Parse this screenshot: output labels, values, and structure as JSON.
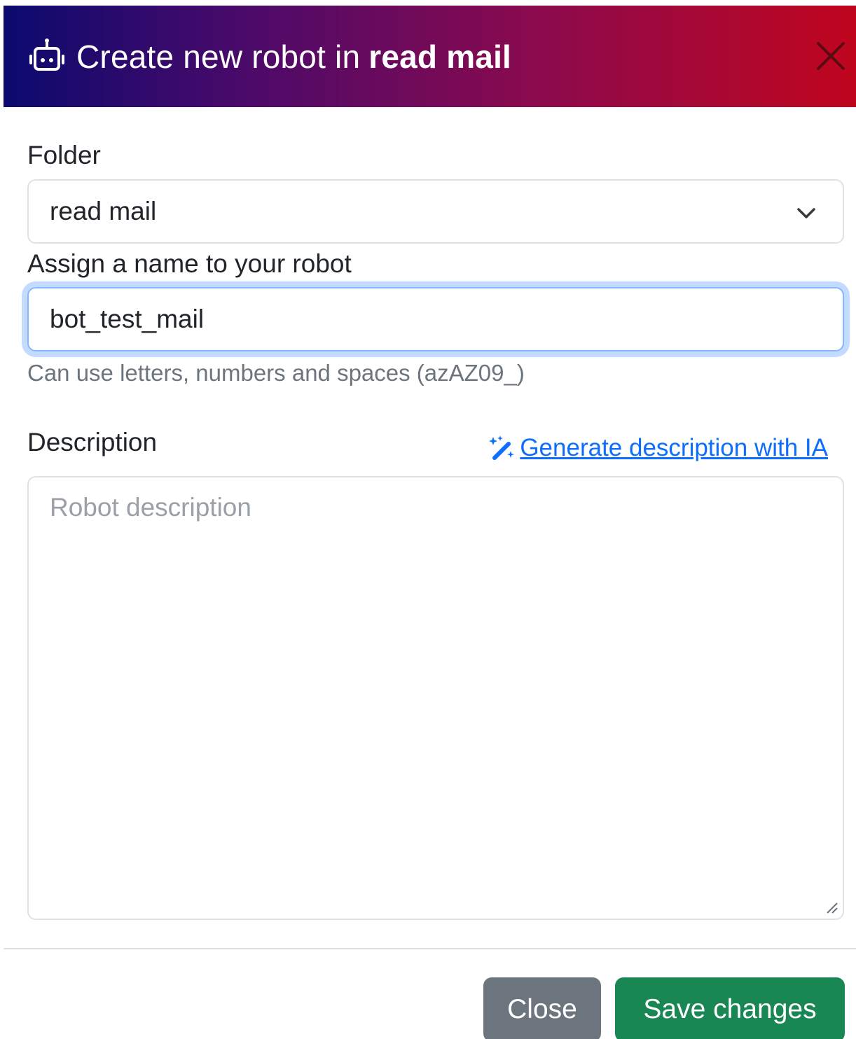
{
  "header": {
    "title_prefix": "Create new robot in",
    "title_folder": "read mail",
    "icon": "robot-icon",
    "close_icon": "close-icon",
    "gradient_colors": [
      "#0b0a6e",
      "#4a0a6a",
      "#8a0a4e",
      "#c0061e"
    ]
  },
  "form": {
    "folder": {
      "label": "Folder",
      "selected": "read mail"
    },
    "name": {
      "label": "Assign a name to your robot",
      "value": "bot_test_mail",
      "help": "Can use letters, numbers and spaces (azAZ09_)"
    },
    "description": {
      "label": "Description",
      "generate_link": "Generate description with IA",
      "placeholder": "Robot description"
    }
  },
  "footer": {
    "close_label": "Close",
    "save_label": "Save changes"
  },
  "colors": {
    "primary": "#0d6efd",
    "secondary": "#6c757d",
    "success": "#198754"
  }
}
